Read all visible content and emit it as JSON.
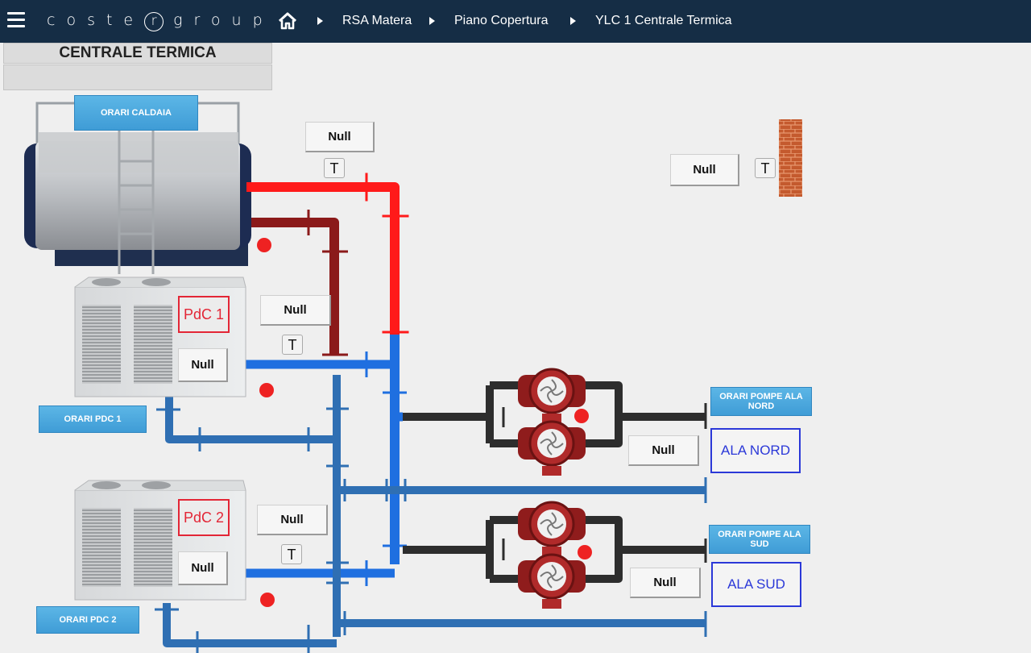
{
  "header": {
    "logo_left": "coste",
    "logo_mark": "r",
    "logo_right": "group",
    "breadcrumbs": [
      "RSA Matera",
      "Piano Copertura",
      "YLC 1 Centrale Termica"
    ]
  },
  "page": {
    "title": "CENTRALE TERMICA",
    "subtitle": ""
  },
  "buttons": {
    "orari_caldaia": "ORARI CALDAIA",
    "orari_pdc1": "ORARI PDC 1",
    "orari_pdc2": "ORARI PDC 2",
    "orari_pompe_nord": "ORARI POMPE ALA NORD",
    "orari_pompe_sud": "ORARI POMPE ALA SUD",
    "ala_nord": "ALA NORD",
    "ala_sud": "ALA SUD"
  },
  "units": {
    "pdc1": "PdC 1",
    "pdc2": "PdC 2"
  },
  "values": {
    "boiler_supply_temp": "Null",
    "outdoor_temp": "Null",
    "pdc1_supply_temp": "Null",
    "pdc1_status": "Null",
    "pdc2_supply_temp": "Null",
    "pdc2_status": "Null",
    "pumps_nord": "Null",
    "pumps_sud": "Null"
  },
  "sensor_symbol": "T",
  "colors": {
    "header_bg": "#152d45",
    "hot_pipe": "#ff1a1a",
    "return_pipe": "#8b1a1a",
    "blue_pipe": "#1f6fe0",
    "steel_pipe": "#2f6fb3",
    "alarm_dot": "#ee2222",
    "ala_border": "#2b38d8"
  }
}
